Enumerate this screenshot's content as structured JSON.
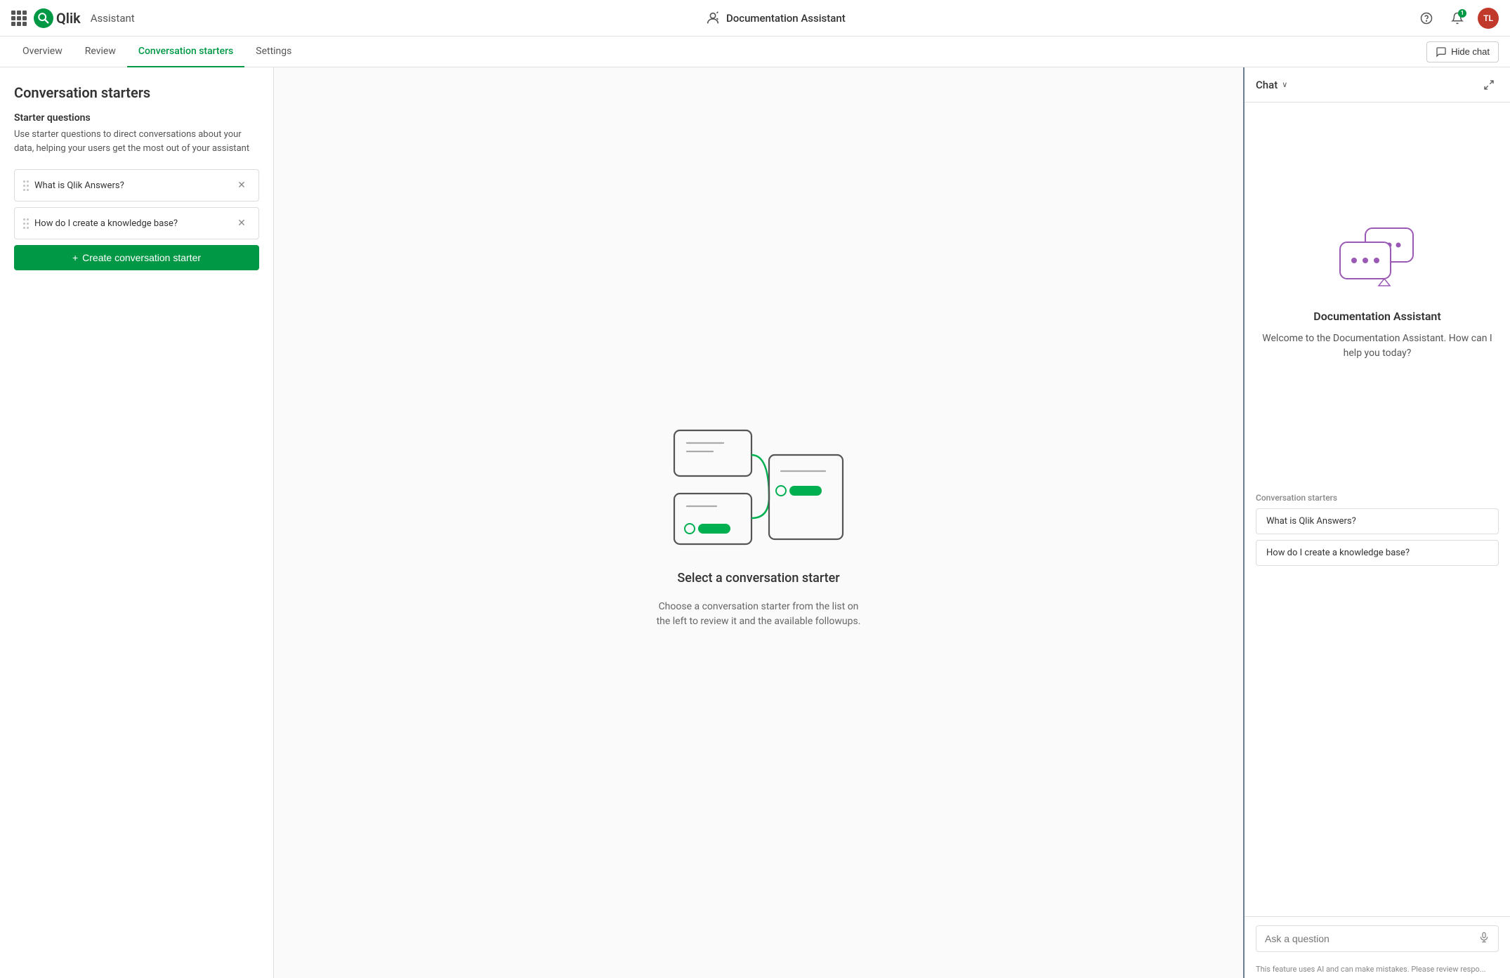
{
  "topbar": {
    "grid_icon_label": "apps",
    "logo_text": "Qlik",
    "app_title": "Assistant",
    "assistant_name": "Documentation Assistant",
    "help_icon": "?",
    "bell_icon": "🔔",
    "notification_count": "1",
    "avatar_initials": "TL"
  },
  "tabs": {
    "items": [
      {
        "id": "overview",
        "label": "Overview",
        "active": false
      },
      {
        "id": "review",
        "label": "Review",
        "active": false
      },
      {
        "id": "conversation-starters",
        "label": "Conversation starters",
        "active": true
      },
      {
        "id": "settings",
        "label": "Settings",
        "active": false
      }
    ],
    "hide_chat_label": "Hide chat"
  },
  "sidebar": {
    "title": "Conversation starters",
    "section_title": "Starter questions",
    "description": "Use starter questions to direct conversations about your data, helping your users get the most out of your assistant",
    "starters": [
      {
        "id": 1,
        "text": "What is Qlik Answers?"
      },
      {
        "id": 2,
        "text": "How do I create a knowledge base?"
      }
    ],
    "create_button_label": "Create conversation starter"
  },
  "center": {
    "title": "Select a conversation starter",
    "description": "Choose a conversation starter from the list on the left to review it and the available followups."
  },
  "chat": {
    "panel_title": "Chat",
    "dropdown_indicator": "∨",
    "assistant_name": "Documentation Assistant",
    "welcome_message": "Welcome to the Documentation Assistant. How can I help you today?",
    "starters_label": "Conversation starters",
    "starters": [
      {
        "id": 1,
        "text": "What is Qlik Answers?"
      },
      {
        "id": 2,
        "text": "How do I create a knowledge base?"
      }
    ],
    "input_placeholder": "Ask a question",
    "disclaimer": "This feature uses AI and can make mistakes. Please review respo..."
  }
}
